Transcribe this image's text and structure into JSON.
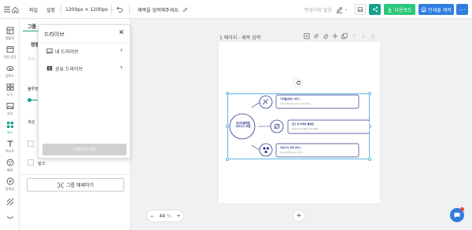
{
  "topbar": {
    "menu_file": "파일",
    "menu_settings": "설정",
    "size": "1200px × 1200px",
    "title_placeholder": "제목을 입력해주세요.",
    "save_status": "변경사항 없음",
    "download_label": "다운로드",
    "print_label": "인쇄물 제작"
  },
  "rail": [
    {
      "label": "템플릿",
      "icon": "template-icon"
    },
    {
      "label": "작업 공간",
      "icon": "workspace-icon"
    },
    {
      "label": "업로드",
      "icon": "upload-icon"
    },
    {
      "label": "도구",
      "icon": "tool-icon"
    },
    {
      "label": "사진",
      "icon": "photo-icon"
    },
    {
      "label": "요소",
      "icon": "element-icon"
    },
    {
      "label": "텍스트",
      "icon": "text-icon"
    },
    {
      "label": "배경",
      "icon": "background-icon"
    },
    {
      "label": "동영상",
      "icon": "video-icon"
    },
    {
      "label": "",
      "icon": "pattern-icon"
    },
    {
      "label": "",
      "icon": "more-icon"
    }
  ],
  "panel": {
    "tab_group": "그룹",
    "align_label": "정렬",
    "size_label": "크기",
    "opacity_label": "불투명도",
    "color_label": "색상",
    "link_label": "링크",
    "ungroup_label": "그룹 해제하기"
  },
  "drive": {
    "title": "드라이브",
    "items": [
      {
        "label": "내 드라이브"
      },
      {
        "label": "공유 드라이브"
      }
    ],
    "import_label": "가져오기 버튼"
  },
  "canvas": {
    "page_label": "1 페이지 - 제목 입력",
    "zoom_value": "44",
    "zoom_unit": "%"
  },
  "infographic": {
    "center_line1": "미디어플랫폼",
    "center_line2": "비즈니스 모델",
    "items": [
      {
        "title": "디지털콘텐츠 서비스",
        "desc": "미디어 콘텐츠의 판매 및 구독형 서비스"
      },
      {
        "title": "광고 및 마케팅 플랫폼",
        "desc": "맞춤형 광고와 데이터 기반 마케팅"
      },
      {
        "title": "커뮤니티 연계 서비스",
        "desc": "사용자 참여형 커뮤니티 운영"
      }
    ]
  },
  "colors": {
    "accent": "#18a08c",
    "download_bg": "#2bc77a",
    "print_bg": "#2f7de1",
    "navy": "#2b3a8c"
  }
}
